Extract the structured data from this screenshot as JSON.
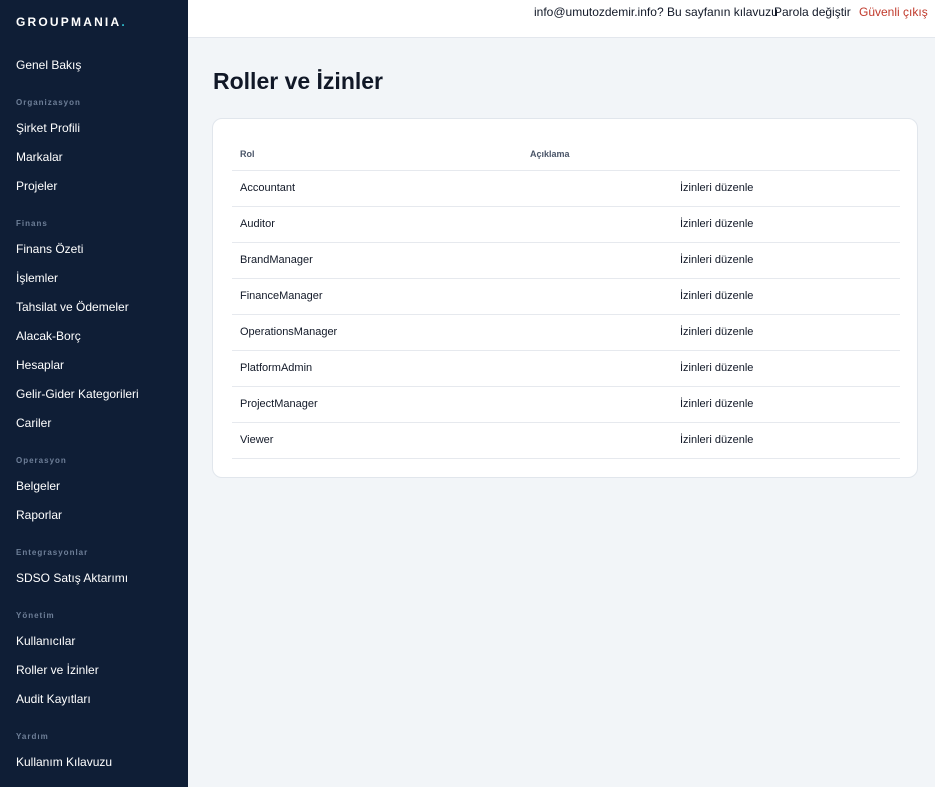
{
  "brand": {
    "name": "GROUPMANIA",
    "dot": "."
  },
  "sidebar": {
    "overview": "Genel Bakış",
    "sections": [
      {
        "title": "Organizasyon",
        "items": [
          "Şirket Profili",
          "Markalar",
          "Projeler"
        ]
      },
      {
        "title": "Finans",
        "items": [
          "Finans Özeti",
          "İşlemler",
          "Tahsilat ve Ödemeler",
          "Alacak-Borç",
          "Hesaplar",
          "Gelir-Gider Kategorileri",
          "Cariler"
        ]
      },
      {
        "title": "Operasyon",
        "items": [
          "Belgeler",
          "Raporlar"
        ]
      },
      {
        "title": "Entegrasyonlar",
        "items": [
          "SDSO Satış Aktarımı"
        ]
      },
      {
        "title": "Yönetim",
        "items": [
          "Kullanıcılar",
          "Roller ve İzinler",
          "Audit Kayıtları"
        ]
      },
      {
        "title": "Yardım",
        "items": [
          "Kullanım Kılavuzu"
        ]
      }
    ]
  },
  "topbar": {
    "email": "info@umutozdemir.info",
    "guide": "? Bu sayfanın kılavuzu",
    "change_password": "Parola değiştir",
    "logout": "Güvenli çıkış"
  },
  "page": {
    "title": "Roller ve İzinler"
  },
  "table": {
    "columns": [
      "Rol",
      "Açıklama"
    ],
    "rows": [
      {
        "role": "Accountant",
        "description": "",
        "action": "İzinleri düzenle"
      },
      {
        "role": "Auditor",
        "description": "",
        "action": "İzinleri düzenle"
      },
      {
        "role": "BrandManager",
        "description": "",
        "action": "İzinleri düzenle"
      },
      {
        "role": "FinanceManager",
        "description": "",
        "action": "İzinleri düzenle"
      },
      {
        "role": "OperationsManager",
        "description": "",
        "action": "İzinleri düzenle"
      },
      {
        "role": "PlatformAdmin",
        "description": "",
        "action": "İzinleri düzenle"
      },
      {
        "role": "ProjectManager",
        "description": "",
        "action": "İzinleri düzenle"
      },
      {
        "role": "Viewer",
        "description": "",
        "action": "İzinleri düzenle"
      }
    ]
  },
  "colors": {
    "sidebar_bg": "#0f1e36",
    "logout": "#c0392b",
    "brand_dot": "#2fc0d0"
  }
}
